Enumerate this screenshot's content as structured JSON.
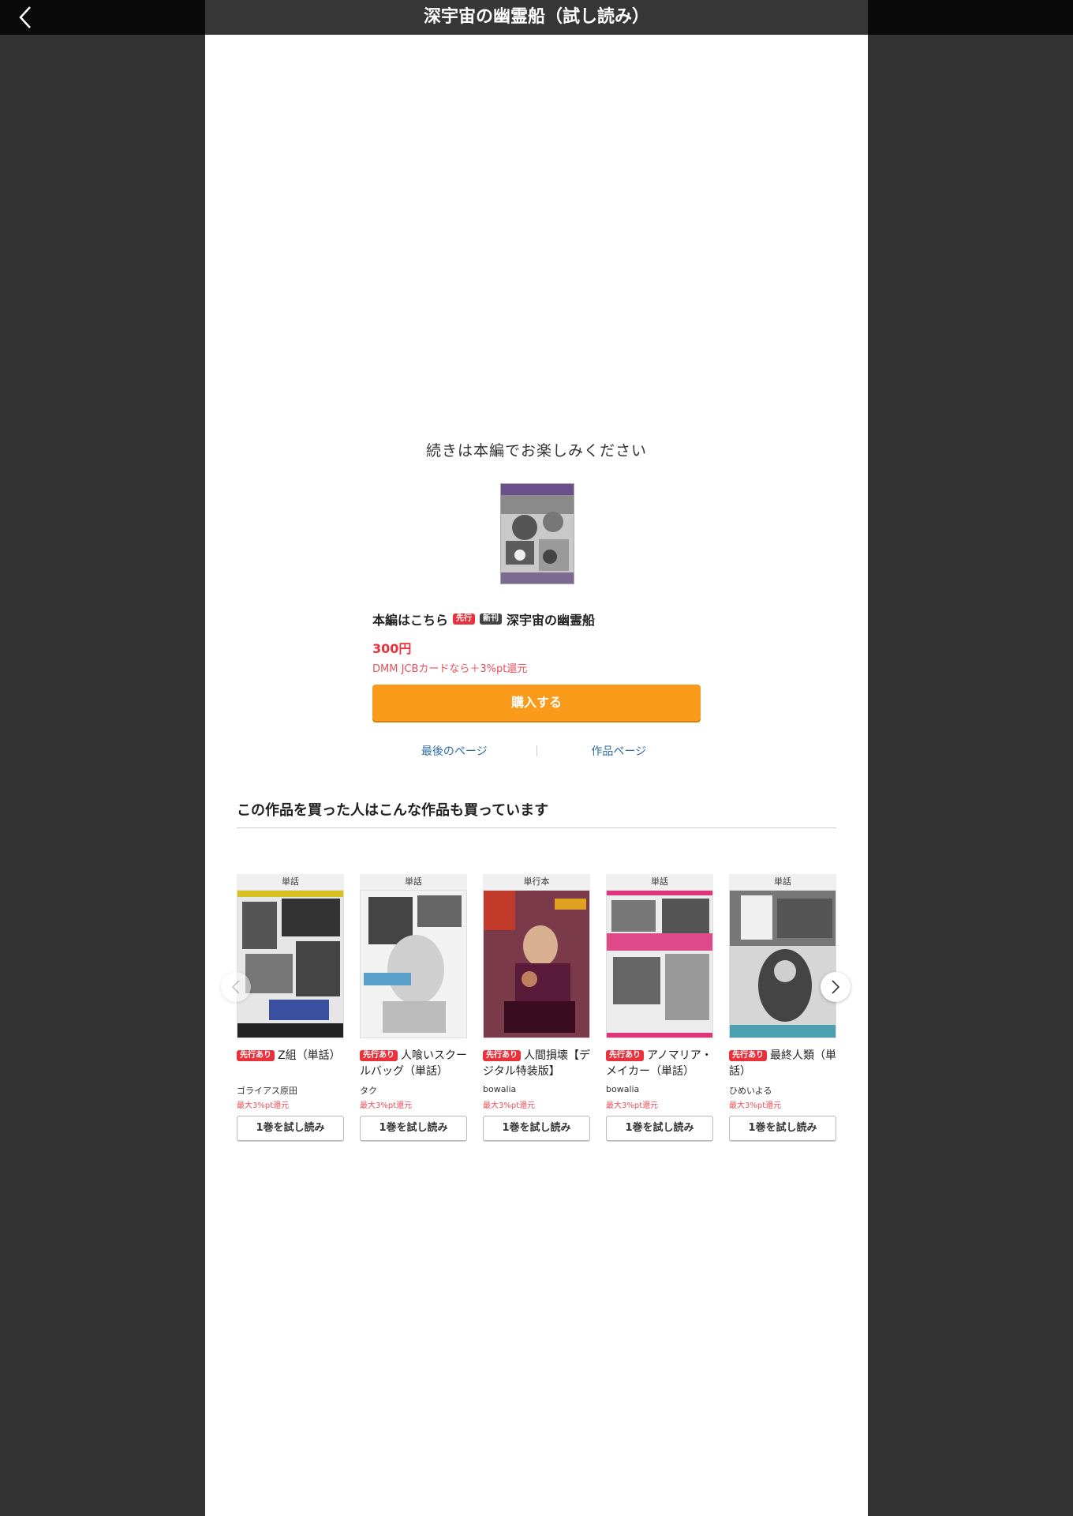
{
  "header": {
    "title": "深宇宙の幽霊船（試し読み）",
    "back_icon": "chevron-left-icon"
  },
  "end_message": "続きは本編でお楽しみください",
  "product": {
    "lead": "本編はこちら",
    "badges": [
      "先行",
      "新刊"
    ],
    "title": "深宇宙の幽霊船",
    "price": "300円",
    "campaign": "DMM JCBカードなら＋3%pt還元",
    "buy_label": "購入する"
  },
  "links": {
    "last_page": "最後のページ",
    "work_page": "作品ページ"
  },
  "recommend": {
    "heading": "この作品を買った人はこんな作品も買っています",
    "items": [
      {
        "kind": "単話",
        "badge": "先行あり",
        "title": "Z組（単話）",
        "author": "ゴライアス原田",
        "pt": "最大3%pt還元",
        "trial": "1巻を試し読み"
      },
      {
        "kind": "単話",
        "badge": "先行あり",
        "title": "人喰いスクールバッグ（単話）",
        "author": "タク",
        "pt": "最大3%pt還元",
        "trial": "1巻を試し読み"
      },
      {
        "kind": "単行本",
        "badge": "先行あり",
        "title": "人間損壊【デジタル特装版】",
        "author": "bowalia",
        "pt": "最大3%pt還元",
        "trial": "1巻を試し読み"
      },
      {
        "kind": "単話",
        "badge": "先行あり",
        "title": "アノマリア・メイカー（単話）",
        "author": "bowalia",
        "pt": "最大3%pt還元",
        "trial": "1巻を試し読み"
      },
      {
        "kind": "単話",
        "badge": "先行あり",
        "title": "最終人類（単話）",
        "author": "ひめいよる",
        "pt": "最大3%pt還元",
        "trial": "1巻を試し読み"
      }
    ]
  },
  "colors": {
    "accent_orange": "#fa9a1a",
    "price_red": "#e8323c",
    "link_blue": "#2f6ea3"
  }
}
